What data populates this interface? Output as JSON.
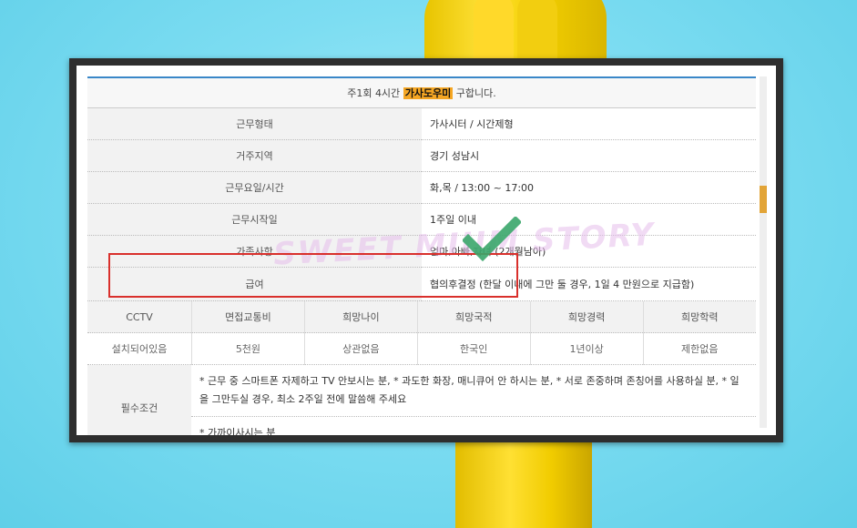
{
  "listing": {
    "title_prefix": "주1회 4시간",
    "title_highlight": "가사도우미",
    "title_suffix": "구합니다.",
    "rows": [
      {
        "label": "근무형태",
        "value": "가사시터 / 시간제형"
      },
      {
        "label": "거주지역",
        "value": "경기 성남시"
      },
      {
        "label": "근무요일/시간",
        "value": "화,목 / 13:00 ~ 17:00"
      },
      {
        "label": "근무시작일",
        "value": "1주일 이내"
      },
      {
        "label": "가족사항",
        "value": "엄마,아빠,자녀 (2개월남아)"
      },
      {
        "label": "급여",
        "value": "협의후결정 (한달 이내에 그만 둘 경우, 1일 4 만원으로 지급함)"
      }
    ],
    "grid_headers": [
      "CCTV",
      "면접교통비",
      "희망나이",
      "희망국적",
      "희망경력",
      "희망학력"
    ],
    "grid_values": [
      "설치되어있음",
      "5천원",
      "상관없음",
      "한국인",
      "1년이상",
      "제한없음"
    ],
    "requirements_label": "필수조건",
    "requirements_text": "* 근무 중 스마트폰 자제하고 TV 안보시는 분, * 과도한 화장, 매니큐어 안 하시는 분, * 서로 존중하며 존칭어를 사용하실 분, * 일을 그만두실 경우, 최소 2주일 전에 말씀해 주세요",
    "requirements_extra": "* 가까이사시는 분"
  },
  "watermark_text": "SWEET MIUM STORY",
  "colors": {
    "highlight": "#f5a623",
    "annotation_red": "#d9302c",
    "check_green": "#3aa66a",
    "accent_blue": "#3a87c8"
  },
  "icons": {
    "check": "check-icon"
  }
}
